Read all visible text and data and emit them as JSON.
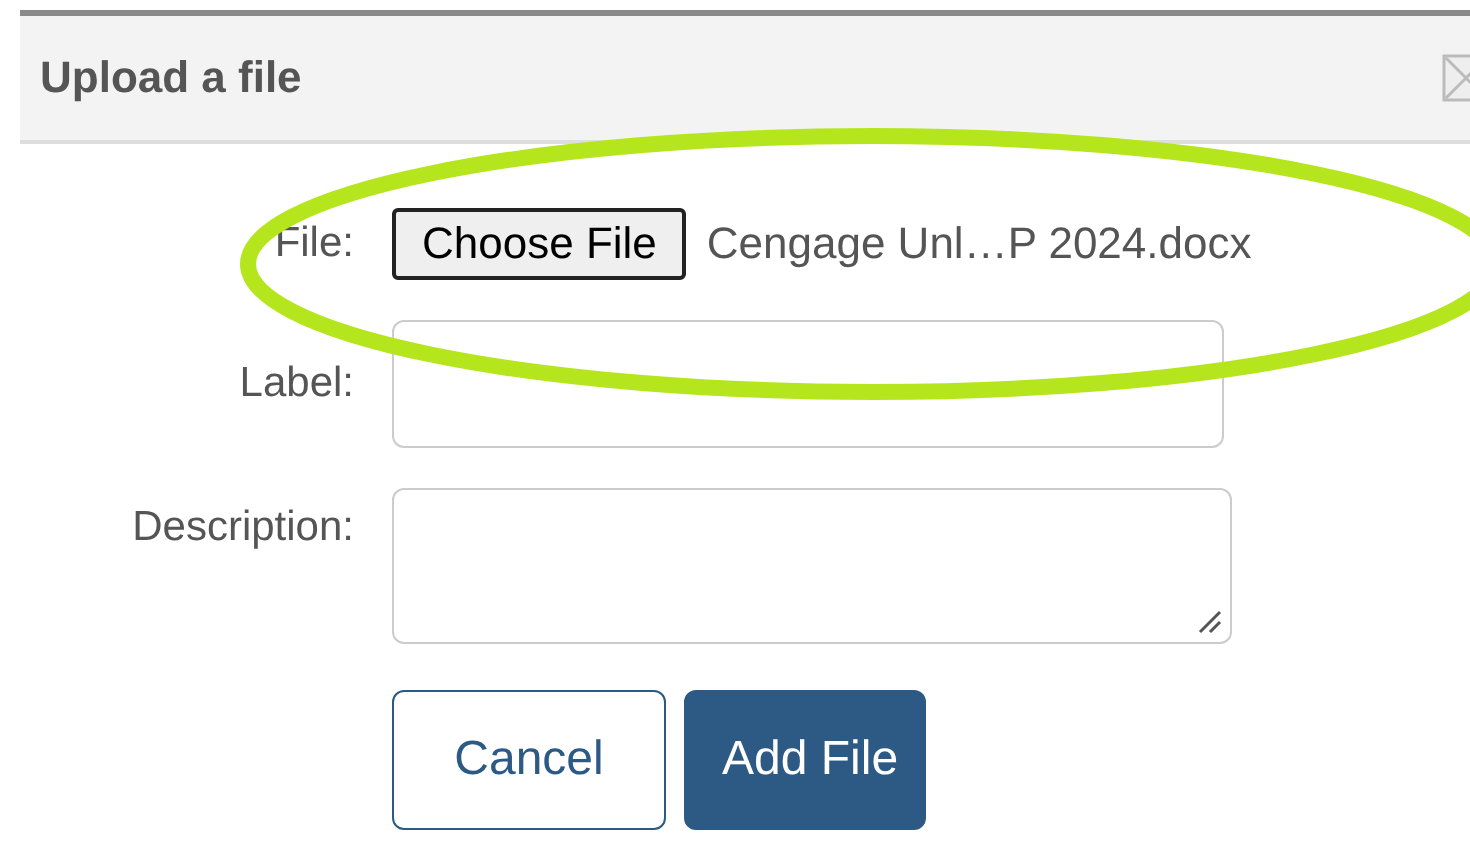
{
  "dialog": {
    "title": "Upload a file"
  },
  "fields": [
    {
      "kind": "file",
      "label": "File:",
      "button": "Choose File",
      "value": "Cengage Unl…P 2024.docx"
    },
    {
      "kind": "text",
      "label": "Label:"
    },
    {
      "kind": "textarea",
      "label": "Description:"
    }
  ],
  "buttons": [
    {
      "kind": "secondary",
      "label": "Cancel"
    },
    {
      "kind": "primary",
      "label": "Add File"
    }
  ],
  "annotation": {
    "kind": "ellipse"
  }
}
